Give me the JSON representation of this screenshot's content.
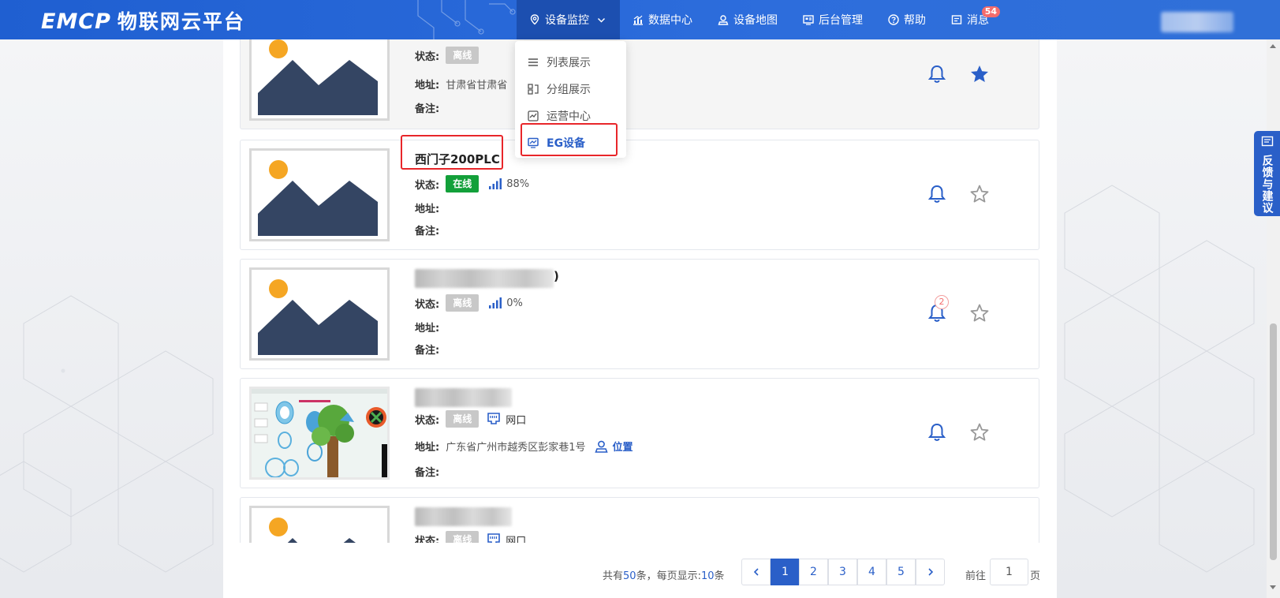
{
  "header": {
    "logo_en": "EMCP",
    "logo_cn": "物联网云平台",
    "nav": [
      {
        "label": "设备监控"
      },
      {
        "label": "数据中心"
      },
      {
        "label": "设备地图"
      },
      {
        "label": "后台管理"
      },
      {
        "label": "帮助"
      },
      {
        "label": "消息"
      }
    ],
    "message_count": "54"
  },
  "dropdown": {
    "items": [
      {
        "label": "列表展示"
      },
      {
        "label": "分组展示"
      },
      {
        "label": "运营中心"
      },
      {
        "label": "EG设备"
      }
    ]
  },
  "labels": {
    "status": "状态:",
    "address": "地址:",
    "remark": "备注:"
  },
  "devices": [
    {
      "name": "",
      "status": "离线",
      "signal": "",
      "network": "",
      "address": "甘肃省甘肃省",
      "location": "",
      "favorite": true
    },
    {
      "name": "西门子200PLC",
      "status": "在线",
      "signal": "88%",
      "network": "",
      "address": "",
      "location": "",
      "favorite": false
    },
    {
      "name": ")",
      "status": "离线",
      "signal": "0%",
      "network": "",
      "address": "",
      "location": "",
      "alarm_count": "2",
      "favorite": false
    },
    {
      "name": "",
      "status": "离线",
      "signal": "",
      "network": "网口",
      "address": "广东省广州市越秀区彭家巷1号",
      "location": "位置",
      "favorite": false
    },
    {
      "name": "",
      "status": "离线",
      "signal": "",
      "network": "网口",
      "address": "",
      "location": "",
      "favorite": false
    }
  ],
  "pagination": {
    "total_prefix": "共有",
    "total": "50",
    "total_mid": "条，每页显示:",
    "page_size": "10",
    "page_size_suffix": "条",
    "pages": [
      "1",
      "2",
      "3",
      "4",
      "5"
    ],
    "current": "1",
    "goto_label": "前往",
    "goto_value": "1",
    "page_suffix": "页"
  },
  "feedback": {
    "label": "反馈与建议"
  },
  "colors": {
    "primary": "#2a5fc8",
    "header": "#2d6ddc",
    "online": "#13a03a",
    "offline": "#c8c8c8",
    "highlight": "#e8262a",
    "badge": "#f56c6c"
  }
}
